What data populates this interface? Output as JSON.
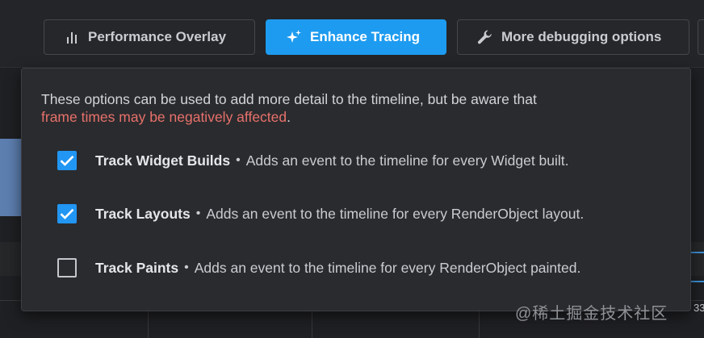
{
  "toolbar": {
    "performance_overlay": "Performance Overlay",
    "enhance_tracing": "Enhance Tracing",
    "more_debugging": "More debugging options"
  },
  "panel": {
    "intro_text": "These options can be used to add more detail to the timeline, but be aware that",
    "warning_text": "frame times may be negatively affected",
    "warning_suffix": ".",
    "separator": "•",
    "options": [
      {
        "title": "Track Widget Builds",
        "description": "Adds an event to the timeline for every Widget built.",
        "checked": true
      },
      {
        "title": "Track Layouts",
        "description": "Adds an event to the timeline for every RenderObject layout.",
        "checked": true
      },
      {
        "title": "Track Paints",
        "description": "Adds an event to the timeline for every RenderObject painted.",
        "checked": false
      }
    ]
  },
  "watermark": "@稀土掘金技术社区",
  "background": {
    "edge_number": "33"
  },
  "colors": {
    "accent": "#1d9bf0",
    "checkbox_checked": "#2196f3",
    "warning": "#e8716b",
    "panel_bg": "#2a2b2e",
    "page_bg": "#202124"
  },
  "icons": {
    "performance_overlay": "bar-chart-icon",
    "enhance_tracing": "sparkle-icon",
    "more_debugging": "wrench-icon",
    "checkbox_checked": "checkmark-icon"
  }
}
